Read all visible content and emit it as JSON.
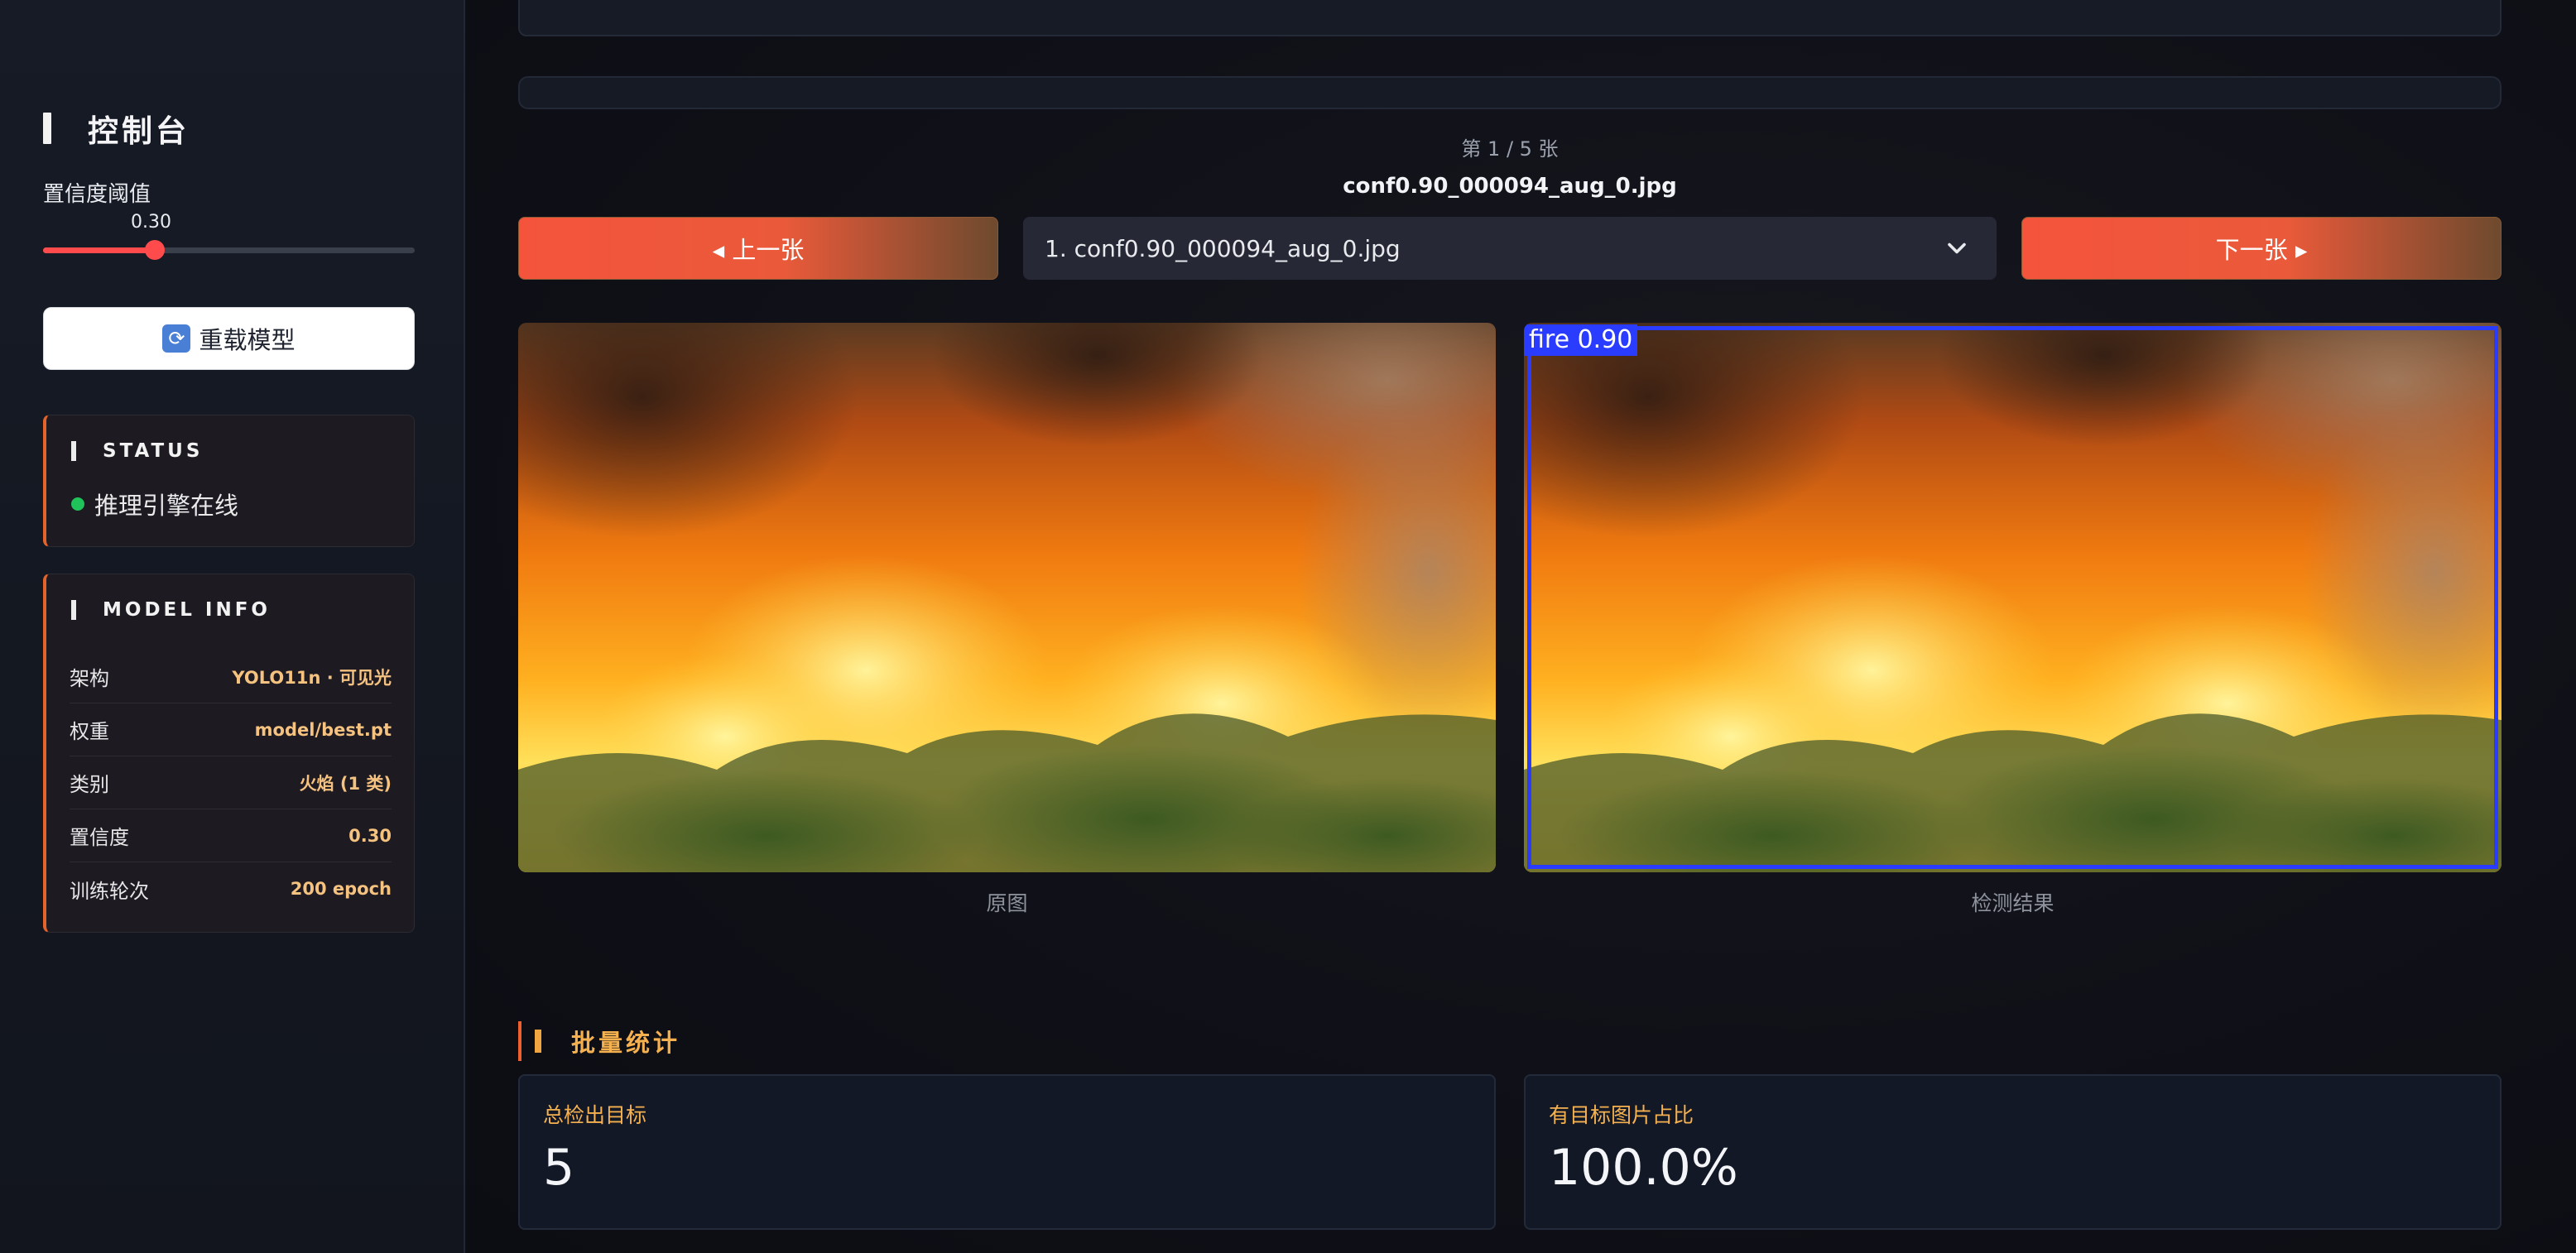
{
  "sidebar": {
    "title": "控制台",
    "slider": {
      "label": "置信度阈值",
      "value_text": "0.30",
      "value": 0.3,
      "min": 0,
      "max": 1
    },
    "reload_label": "重载模型",
    "status": {
      "heading": "STATUS",
      "text": "推理引擎在线",
      "color": "#20c35a"
    },
    "model_info": {
      "heading": "MODEL INFO",
      "rows": [
        {
          "k": "架构",
          "v": "YOLO11n · 可见光"
        },
        {
          "k": "权重",
          "v": "model/best.pt"
        },
        {
          "k": "类别",
          "v": "火焰 (1 类)"
        },
        {
          "k": "置信度",
          "v": "0.30"
        },
        {
          "k": "训练轮次",
          "v": "200 epoch"
        }
      ]
    }
  },
  "main": {
    "counter": "第 1 / 5 张",
    "filename": "conf0.90_000094_aug_0.jpg",
    "prev_label": "◂ 上一张",
    "next_label": "下一张 ▸",
    "select_value": "1. conf0.90_000094_aug_0.jpg",
    "original_caption": "原图",
    "result_caption": "检测结果",
    "detection_label": "fire 0.90",
    "batch_title": "批量统计",
    "stats": [
      {
        "label": "总检出目标",
        "value": "5"
      },
      {
        "label": "有目标图片占比",
        "value": "100.0%"
      }
    ]
  },
  "colors": {
    "accent": "#f4533c",
    "detect_box": "#2a3cff",
    "stat_label": "#f5b14f"
  }
}
